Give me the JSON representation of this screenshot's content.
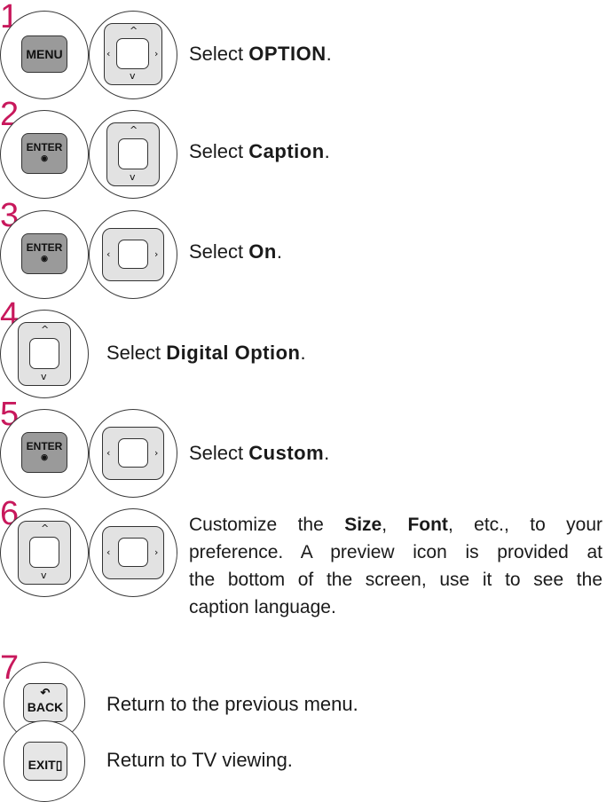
{
  "steps": [
    {
      "number": "1",
      "select_prefix": "Select ",
      "target": "OPTION",
      "suffix": "."
    },
    {
      "number": "2",
      "select_prefix": "Select ",
      "target": "Caption",
      "suffix": "."
    },
    {
      "number": "3",
      "select_prefix": "Select ",
      "target": "On",
      "suffix": "."
    },
    {
      "number": "4",
      "select_prefix": "Select ",
      "target": "Digital Option",
      "suffix": "."
    },
    {
      "number": "5",
      "select_prefix": "Select ",
      "target": "Custom",
      "suffix": "."
    },
    {
      "number": "6",
      "prefix": "Customize the ",
      "size": "Size",
      "comma": ", ",
      "font": "Font",
      "rest_line1": ", etc., to your",
      "line2": "preference. A preview icon is provided at",
      "line3": "the bottom of the screen, use it to see the",
      "line4": "caption language."
    },
    {
      "number": "7",
      "text": "Return to the previous menu."
    },
    {
      "text": "Return to TV viewing."
    }
  ],
  "keys": {
    "menu": "MENU",
    "enter": "ENTER",
    "enter_dot": "◉",
    "back_label": "BACK",
    "back_arrow": "↶",
    "exit_label": "EXIT",
    "exit_mark": "▯"
  },
  "arrows": {
    "up": "^",
    "down": "v",
    "left": "‹",
    "right": "›"
  },
  "colors": {
    "step_number": "#c8185c",
    "key_gray": "#9a9a9a",
    "dpad_gray": "#e2e2e2"
  }
}
